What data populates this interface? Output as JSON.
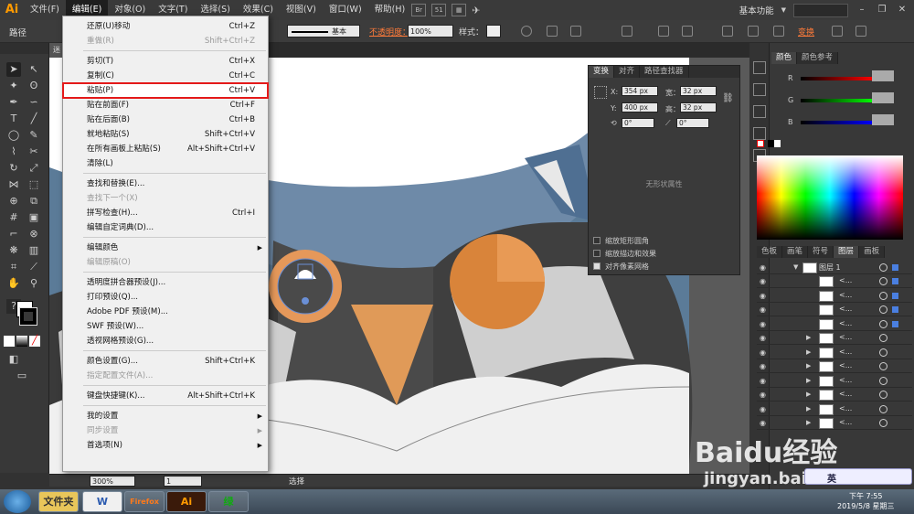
{
  "app": {
    "logo": "Ai"
  },
  "menubar": {
    "items": [
      "文件(F)",
      "编辑(E)",
      "对象(O)",
      "文字(T)",
      "选择(S)",
      "效果(C)",
      "视图(V)",
      "窗口(W)",
      "帮助(H)"
    ],
    "workspace": "基本功能",
    "zoom_badge": "51"
  },
  "controlbar": {
    "path_label": "路径",
    "stroke_style": "基本",
    "opacity_label": "不透明度：",
    "opacity_value": "100%",
    "style_label": "样式：",
    "transform_link": "变换"
  },
  "edit_menu": {
    "items": [
      {
        "label": "还原(U)移动",
        "shortcut": "Ctrl+Z",
        "disabled": false
      },
      {
        "label": "重做(R)",
        "shortcut": "Shift+Ctrl+Z",
        "disabled": true
      },
      {
        "label": "剪切(T)",
        "shortcut": "Ctrl+X",
        "disabled": false
      },
      {
        "label": "复制(C)",
        "shortcut": "Ctrl+C",
        "disabled": false
      },
      {
        "label": "粘贴(P)",
        "shortcut": "Ctrl+V",
        "disabled": false
      },
      {
        "label": "贴在前面(F)",
        "shortcut": "Ctrl+F",
        "disabled": false
      },
      {
        "label": "贴在后面(B)",
        "shortcut": "Ctrl+B",
        "disabled": false
      },
      {
        "label": "就地粘贴(S)",
        "shortcut": "Shift+Ctrl+V",
        "disabled": false
      },
      {
        "label": "在所有画板上粘贴(S)",
        "shortcut": "Alt+Shift+Ctrl+V",
        "disabled": false
      },
      {
        "label": "清除(L)",
        "shortcut": "",
        "disabled": false
      },
      {
        "label": "查找和替换(E)...",
        "shortcut": "",
        "disabled": false
      },
      {
        "label": "查找下一个(X)",
        "shortcut": "",
        "disabled": true
      },
      {
        "label": "拼写检查(H)...",
        "shortcut": "Ctrl+I",
        "disabled": false
      },
      {
        "label": "编辑自定词典(D)...",
        "shortcut": "",
        "disabled": false
      },
      {
        "label": "编辑颜色",
        "shortcut": "",
        "disabled": false,
        "submenu": true
      },
      {
        "label": "编辑原稿(O)",
        "shortcut": "",
        "disabled": true
      },
      {
        "label": "透明度拼合器预设(J)...",
        "shortcut": "",
        "disabled": false
      },
      {
        "label": "打印预设(Q)...",
        "shortcut": "",
        "disabled": false
      },
      {
        "label": "Adobe PDF 预设(M)...",
        "shortcut": "",
        "disabled": false
      },
      {
        "label": "SWF 预设(W)...",
        "shortcut": "",
        "disabled": false
      },
      {
        "label": "透视网格预设(G)...",
        "shortcut": "",
        "disabled": false
      },
      {
        "label": "颜色设置(G)...",
        "shortcut": "Shift+Ctrl+K",
        "disabled": false
      },
      {
        "label": "指定配置文件(A)...",
        "shortcut": "",
        "disabled": true
      },
      {
        "label": "键盘快捷键(K)...",
        "shortcut": "Alt+Shift+Ctrl+K",
        "disabled": false
      },
      {
        "label": "我的设置",
        "shortcut": "",
        "disabled": false,
        "submenu": true
      },
      {
        "label": "同步设置",
        "shortcut": "",
        "disabled": true,
        "submenu": true
      },
      {
        "label": "首选项(N)",
        "shortcut": "",
        "disabled": false,
        "submenu": true
      }
    ]
  },
  "transform_panel": {
    "tabs": [
      "变换",
      "对齐",
      "路径查找器"
    ],
    "x_label": "X:",
    "x_value": "354 px",
    "y_label": "Y:",
    "y_value": "400 px",
    "w_label": "宽：",
    "w_value": "32 px",
    "h_label": "高：",
    "h_value": "32 px",
    "angle1": "0°",
    "angle2": "0°",
    "no_props": "无形状属性",
    "checks": [
      "缩放矩形圆角",
      "缩放描边和效果",
      "对齐像素网格"
    ]
  },
  "color_panel": {
    "tabs": [
      "颜色",
      "颜色参考"
    ],
    "channels": [
      "R",
      "G",
      "B"
    ]
  },
  "layers_panel": {
    "tabs": [
      "色板",
      "画笔",
      "符号",
      "图层",
      "画板"
    ],
    "layer_name": "图层 1",
    "sublayer_name": "<...",
    "sublayer_count": 11
  },
  "statusbar": {
    "zoom": "300%",
    "page": "1",
    "tool": "选择"
  },
  "doc_tab": "迷",
  "taskbar": {
    "apps": [
      "文件夹",
      "W",
      "Firefox",
      "Ai",
      "绿"
    ],
    "time": "下午 7:55",
    "date": "2019/5/8 星期三"
  },
  "watermark": {
    "text": "Baidu经验",
    "url": "jingyan.baidu.com"
  },
  "ime": "英"
}
